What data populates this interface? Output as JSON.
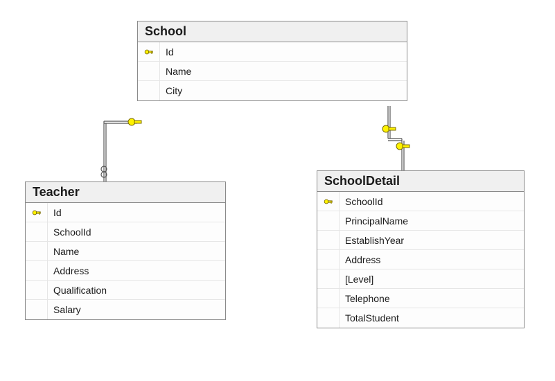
{
  "tables": {
    "school": {
      "title": "School",
      "columns": [
        {
          "name": "Id",
          "pk": true
        },
        {
          "name": "Name",
          "pk": false
        },
        {
          "name": "City",
          "pk": false
        }
      ]
    },
    "teacher": {
      "title": "Teacher",
      "columns": [
        {
          "name": "Id",
          "pk": true
        },
        {
          "name": "SchoolId",
          "pk": false
        },
        {
          "name": "Name",
          "pk": false
        },
        {
          "name": "Address",
          "pk": false
        },
        {
          "name": "Qualification",
          "pk": false
        },
        {
          "name": "Salary",
          "pk": false
        }
      ]
    },
    "schooldetail": {
      "title": "SchoolDetail",
      "columns": [
        {
          "name": "SchoolId",
          "pk": true
        },
        {
          "name": "PrincipalName",
          "pk": false
        },
        {
          "name": "EstablishYear",
          "pk": false
        },
        {
          "name": "Address",
          "pk": false
        },
        {
          "name": "[Level]",
          "pk": false
        },
        {
          "name": "Telephone",
          "pk": false
        },
        {
          "name": "TotalStudent",
          "pk": false
        }
      ]
    }
  },
  "relations": [
    {
      "from": "School",
      "to": "Teacher",
      "type": "one-to-many"
    },
    {
      "from": "School",
      "to": "SchoolDetail",
      "type": "one-to-one"
    }
  ]
}
